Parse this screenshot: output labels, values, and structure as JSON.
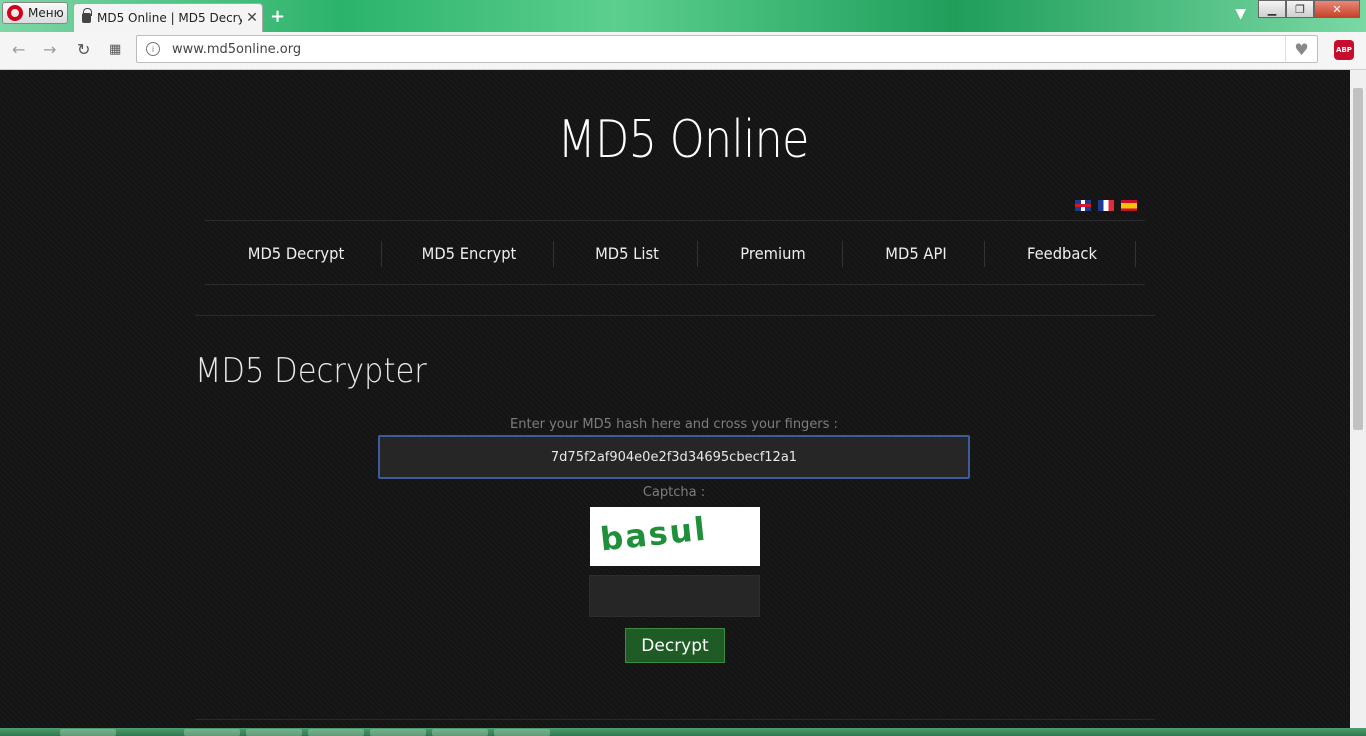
{
  "browser": {
    "menu_label": "Меню",
    "tab_title": "MD5 Online | MD5 Decryp",
    "tab_close": "✕",
    "new_tab": "+",
    "url": "www.md5online.org",
    "abp_label": "ABP"
  },
  "header": {
    "site_title": "MD5 Online"
  },
  "nav": {
    "items": [
      {
        "label": "MD5 Decrypt"
      },
      {
        "label": "MD5 Encrypt"
      },
      {
        "label": "MD5 List"
      },
      {
        "label": "Premium"
      },
      {
        "label": "MD5 API"
      },
      {
        "label": "Feedback"
      }
    ]
  },
  "main": {
    "section_title": "MD5 Decrypter",
    "hash_label": "Enter your MD5 hash here and cross your fingers :",
    "hash_value": "7d75f2af904e0e2f3d34695cbecf12a1",
    "captcha_label": "Captcha :",
    "captcha_text": "basul",
    "captcha_value": "",
    "decrypt_label": "Decrypt"
  },
  "colors": {
    "page_bg": "#141414",
    "button_green": "#1f5c25",
    "input_border": "#3d5c9a"
  }
}
